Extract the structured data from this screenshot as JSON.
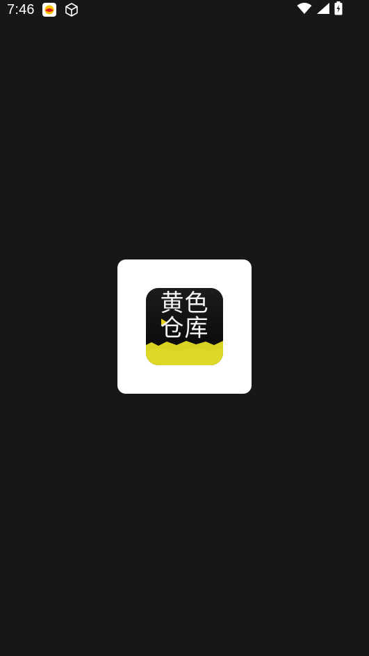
{
  "status_bar": {
    "time": "7:46",
    "notification_icons": [
      "app-notification-icon",
      "package-icon"
    ],
    "system_icons": [
      "wifi-icon",
      "cellular-signal-icon",
      "battery-charging-icon"
    ]
  },
  "splash": {
    "logo_text": "黄色\n仓库",
    "logo_tagline": "",
    "colors": {
      "background": "#171717",
      "card": "#ffffff",
      "logo_background": "#0d0d0d",
      "logo_accent": "#d8d222"
    }
  }
}
